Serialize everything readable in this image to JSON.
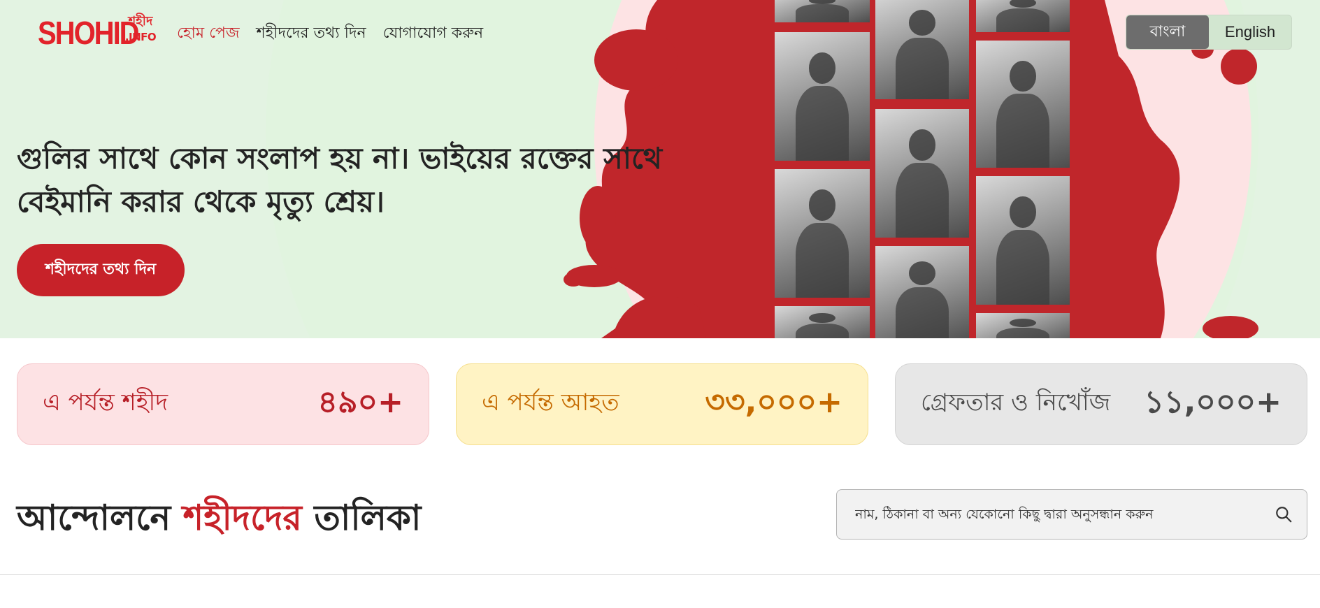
{
  "brand": {
    "logo_text": "SHOHID",
    "logo_side_text": "শহীদ",
    "logo_side_sub": ".INFO"
  },
  "nav": {
    "items": [
      {
        "label": "হোম পেজ",
        "active": true
      },
      {
        "label": "শহীদদের তথ্য দিন",
        "active": false
      },
      {
        "label": "যোগাযোগ করুন",
        "active": false
      }
    ]
  },
  "language": {
    "options": [
      {
        "label": "বাংলা",
        "selected": true
      },
      {
        "label": "English",
        "selected": false
      }
    ]
  },
  "hero": {
    "headline": "গুলির সাথে কোন সংলাপ হয় না। ভাইয়ের রক্তের সাথে বেইমানি করার থেকে মৃত্যু শ্রেয়।",
    "cta_label": "শহীদদের তথ্য দিন"
  },
  "stats": [
    {
      "label": "এ পর্যন্ত শহীদ",
      "value": "৪৯০+"
    },
    {
      "label": "এ পর্যন্ত আহত",
      "value": "৩৩,০০০+"
    },
    {
      "label": "গ্রেফতার ও নিখোঁজ",
      "value": "১১,০০০+"
    }
  ],
  "list_section": {
    "title_before": "আন্দোলনে ",
    "title_highlight": "শহীদদের",
    "title_after": " তালিকা"
  },
  "search": {
    "placeholder": "নাম, ঠিকানা বা অন্য যেকোনো কিছু দ্বারা অনুসন্ধান করুন",
    "value": ""
  },
  "colors": {
    "accent_red": "#c72229",
    "logo_red": "#e2232a",
    "hero_green": "#e3f3e2",
    "hero_pink": "#fde3e4",
    "stat_yellow_text": "#c56a00",
    "stat_gray_text": "#4a4a4a"
  },
  "icons": [
    "search-icon"
  ]
}
